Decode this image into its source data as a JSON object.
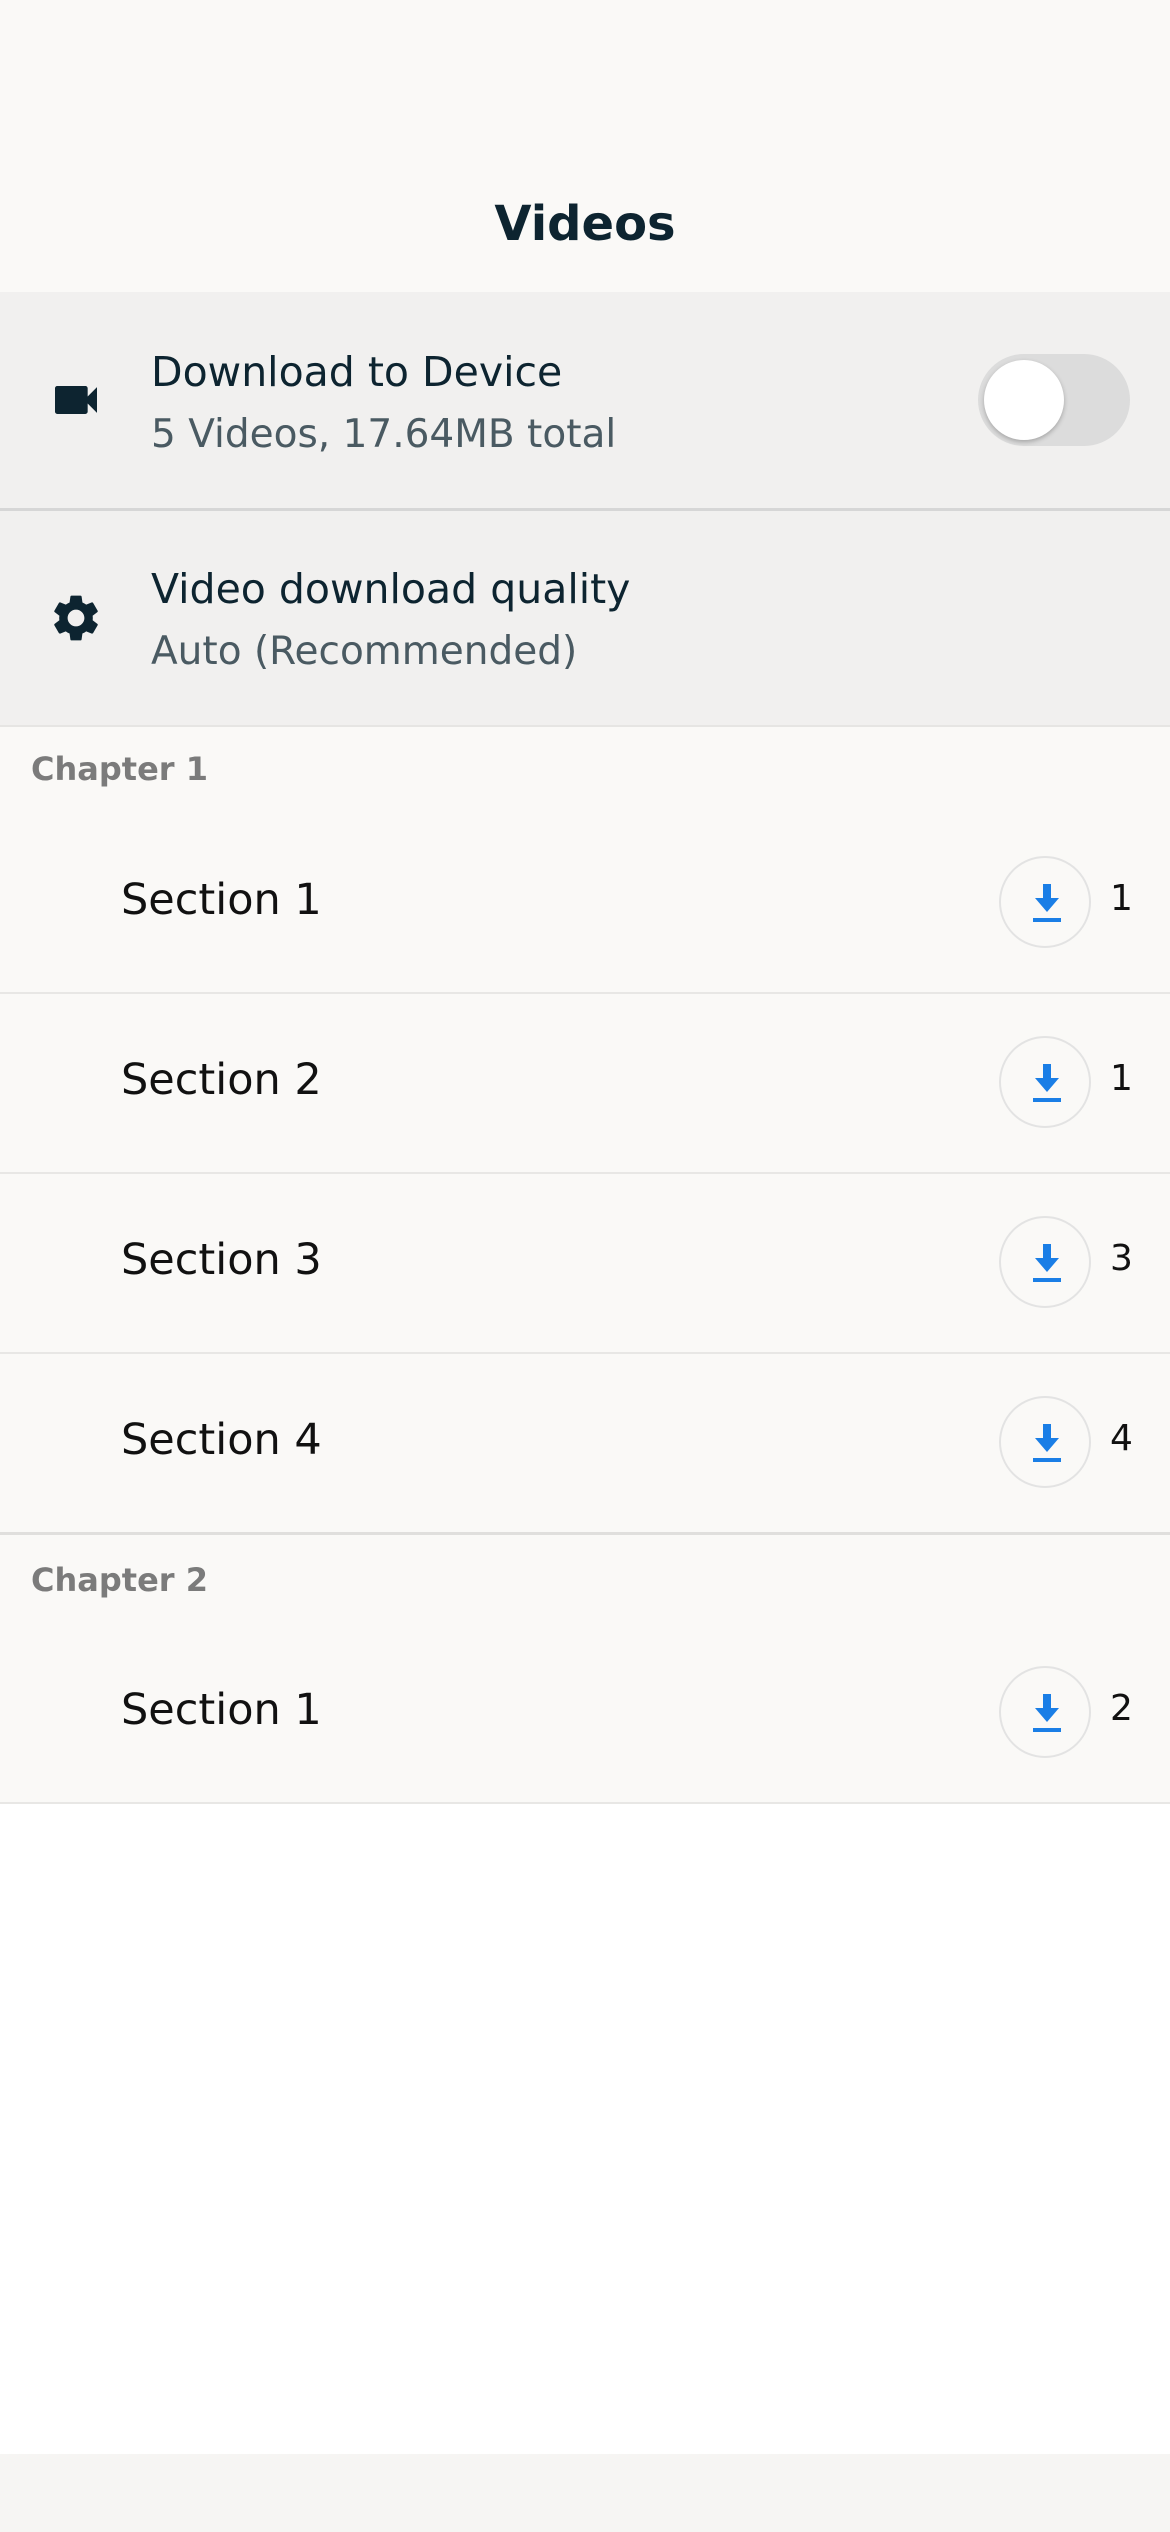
{
  "header": {
    "title": "Videos"
  },
  "settings": {
    "download_to_device": {
      "icon": "video-camera-icon",
      "title": "Download to Device",
      "subtitle": "5 Videos, 17.64MB total",
      "toggle_on": false
    },
    "video_quality": {
      "icon": "gear-icon",
      "title": "Video download quality",
      "subtitle": "Auto (Recommended)"
    }
  },
  "chapters": [
    {
      "title": "Chapter 1",
      "sections": [
        {
          "label": "Section 1",
          "count": "1"
        },
        {
          "label": "Section 2",
          "count": "1"
        },
        {
          "label": "Section 3",
          "count": "3"
        },
        {
          "label": "Section 4",
          "count": "4"
        }
      ]
    },
    {
      "title": "Chapter 2",
      "sections": [
        {
          "label": "Section 1",
          "count": "2"
        }
      ]
    }
  ],
  "colors": {
    "accent": "#1a7ee6",
    "text_primary": "#0d2430",
    "chapter_header": "#7b7b7b",
    "toggle_off": "#dcdcdc"
  },
  "icons": {
    "section_action": "download-icon"
  }
}
